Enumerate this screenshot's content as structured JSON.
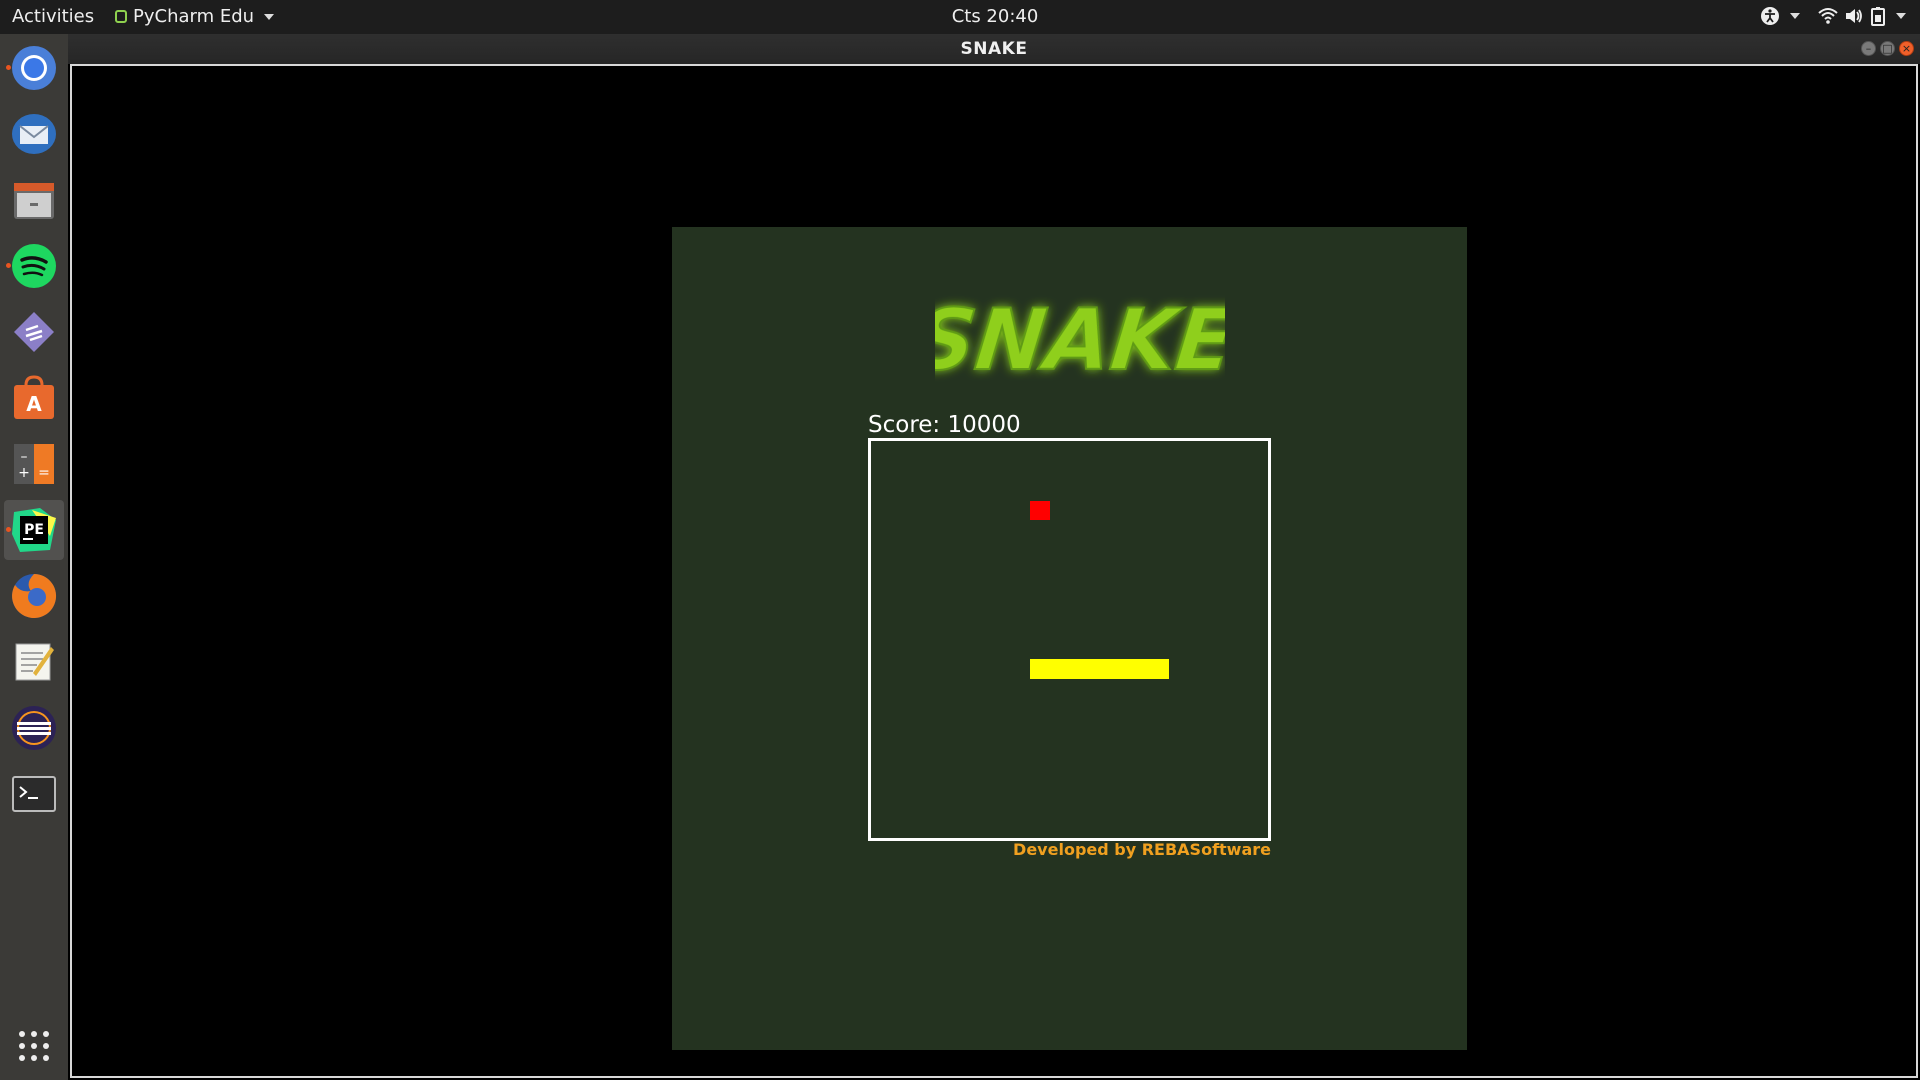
{
  "topbar": {
    "activities": "Activities",
    "app_menu": "PyCharm Edu",
    "clock": "Cts 20:40"
  },
  "window": {
    "title": "SNAKE"
  },
  "dock": {
    "items": [
      {
        "name": "chrome",
        "icon": "chrome-icon",
        "running": true
      },
      {
        "name": "thunderbird",
        "icon": "thunderbird-icon",
        "running": false
      },
      {
        "name": "files",
        "icon": "files-icon",
        "running": false
      },
      {
        "name": "spotify",
        "icon": "spotify-icon",
        "running": true
      },
      {
        "name": "sublime",
        "icon": "sublime-icon",
        "running": false
      },
      {
        "name": "software",
        "icon": "software-center-icon",
        "running": false
      },
      {
        "name": "calculator",
        "icon": "calculator-icon",
        "running": false
      },
      {
        "name": "pycharm",
        "icon": "pycharm-icon",
        "running": true,
        "active": true
      },
      {
        "name": "firefox",
        "icon": "firefox-icon",
        "running": false
      },
      {
        "name": "text-editor",
        "icon": "text-editor-icon",
        "running": false
      },
      {
        "name": "eclipse",
        "icon": "eclipse-icon",
        "running": false
      },
      {
        "name": "terminal",
        "icon": "terminal-icon",
        "running": false
      }
    ],
    "show_apps": "app-grid-icon"
  },
  "game": {
    "logo_text": "SNAKE",
    "score_label": "Score: 10000",
    "credit": "Developed by REBASoftware",
    "colors": {
      "panel_bg": "#243320",
      "food": "#ff0000",
      "snake": "#ffff00",
      "credit": "#f0a020",
      "logo": "#8fcf1a"
    },
    "grid": {
      "cells": 20,
      "food": {
        "col": 8,
        "row": 3
      },
      "snake": [
        {
          "col": 8,
          "row": 11
        },
        {
          "col": 9,
          "row": 11
        },
        {
          "col": 10,
          "row": 11
        },
        {
          "col": 11,
          "row": 11
        },
        {
          "col": 12,
          "row": 11
        },
        {
          "col": 13,
          "row": 11
        },
        {
          "col": 14,
          "row": 11
        }
      ]
    }
  }
}
